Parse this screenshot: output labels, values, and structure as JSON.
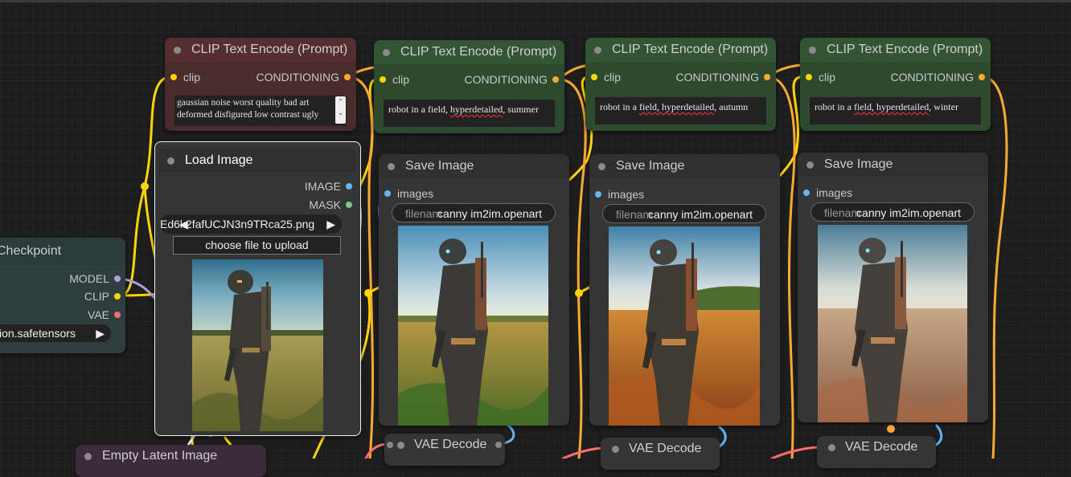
{
  "colors": {
    "clip_socket": "#ffd500",
    "conditioning_socket": "#ffa931",
    "image_socket": "#64b5f6",
    "mask_socket": "#81c784",
    "model_socket": "#b39ddb",
    "vae_socket": "#ff6e6e",
    "negative_node": "#4b2c2c",
    "positive_node": "#2d4a2f",
    "checkpoint_node": "#2e3d3d"
  },
  "negative_prompt_node": {
    "title": "CLIP Text Encode (Prompt)",
    "input_label": "clip",
    "output_label": "CONDITIONING",
    "text_line1": "gaussian noise worst quality bad art",
    "text_line2": "deformed disfigured low contrast ugly"
  },
  "prompt_nodes": [
    {
      "title": "CLIP Text Encode (Prompt)",
      "input_label": "clip",
      "output_label": "CONDITIONING",
      "text_pre": "robot in a field, ",
      "text_sq": "hyperdetailed",
      "text_post": ", summer"
    },
    {
      "title": "CLIP Text Encode (Prompt)",
      "input_label": "clip",
      "output_label": "CONDITIONING",
      "text_pre": "robot in a ",
      "text_sq": "field, hyperdetailed",
      "text_post": ", autumn"
    },
    {
      "title": "CLIP Text Encode (Prompt)",
      "input_label": "clip",
      "output_label": "CONDITIONING",
      "text_pre": "robot in a ",
      "text_sq": "field, hyperdetailed",
      "text_post": ", winter"
    }
  ],
  "load_image": {
    "title": "Load Image",
    "output_image": "IMAGE",
    "output_mask": "MASK",
    "file_name": "Ed6k2fafUCJN3n9TRca25.png",
    "upload_button": "choose file to upload"
  },
  "checkpoint": {
    "title": "Checkpoint",
    "output_model": "MODEL",
    "output_clip": "CLIP",
    "output_vae": "VAE",
    "ckpt_value": "sion.safetensors"
  },
  "save_images": [
    {
      "title": "Save Image",
      "input_label": "images",
      "prefix_label": "filenam",
      "prefix_value": "canny im2im.openart"
    },
    {
      "title": "Save Image",
      "input_label": "images",
      "prefix_label": "filenam",
      "prefix_value": "canny im2im.openart"
    },
    {
      "title": "Save Image",
      "input_label": "images",
      "prefix_label": "filenam",
      "prefix_value": "canny im2im.openart"
    }
  ],
  "vae_decodes": [
    {
      "title": "VAE Decode"
    },
    {
      "title": "VAE Decode"
    },
    {
      "title": "VAE Decode"
    }
  ],
  "empty_latent": {
    "title": "Empty Latent Image"
  },
  "icons": {
    "arrow_left": "◀",
    "arrow_right": "▶"
  }
}
